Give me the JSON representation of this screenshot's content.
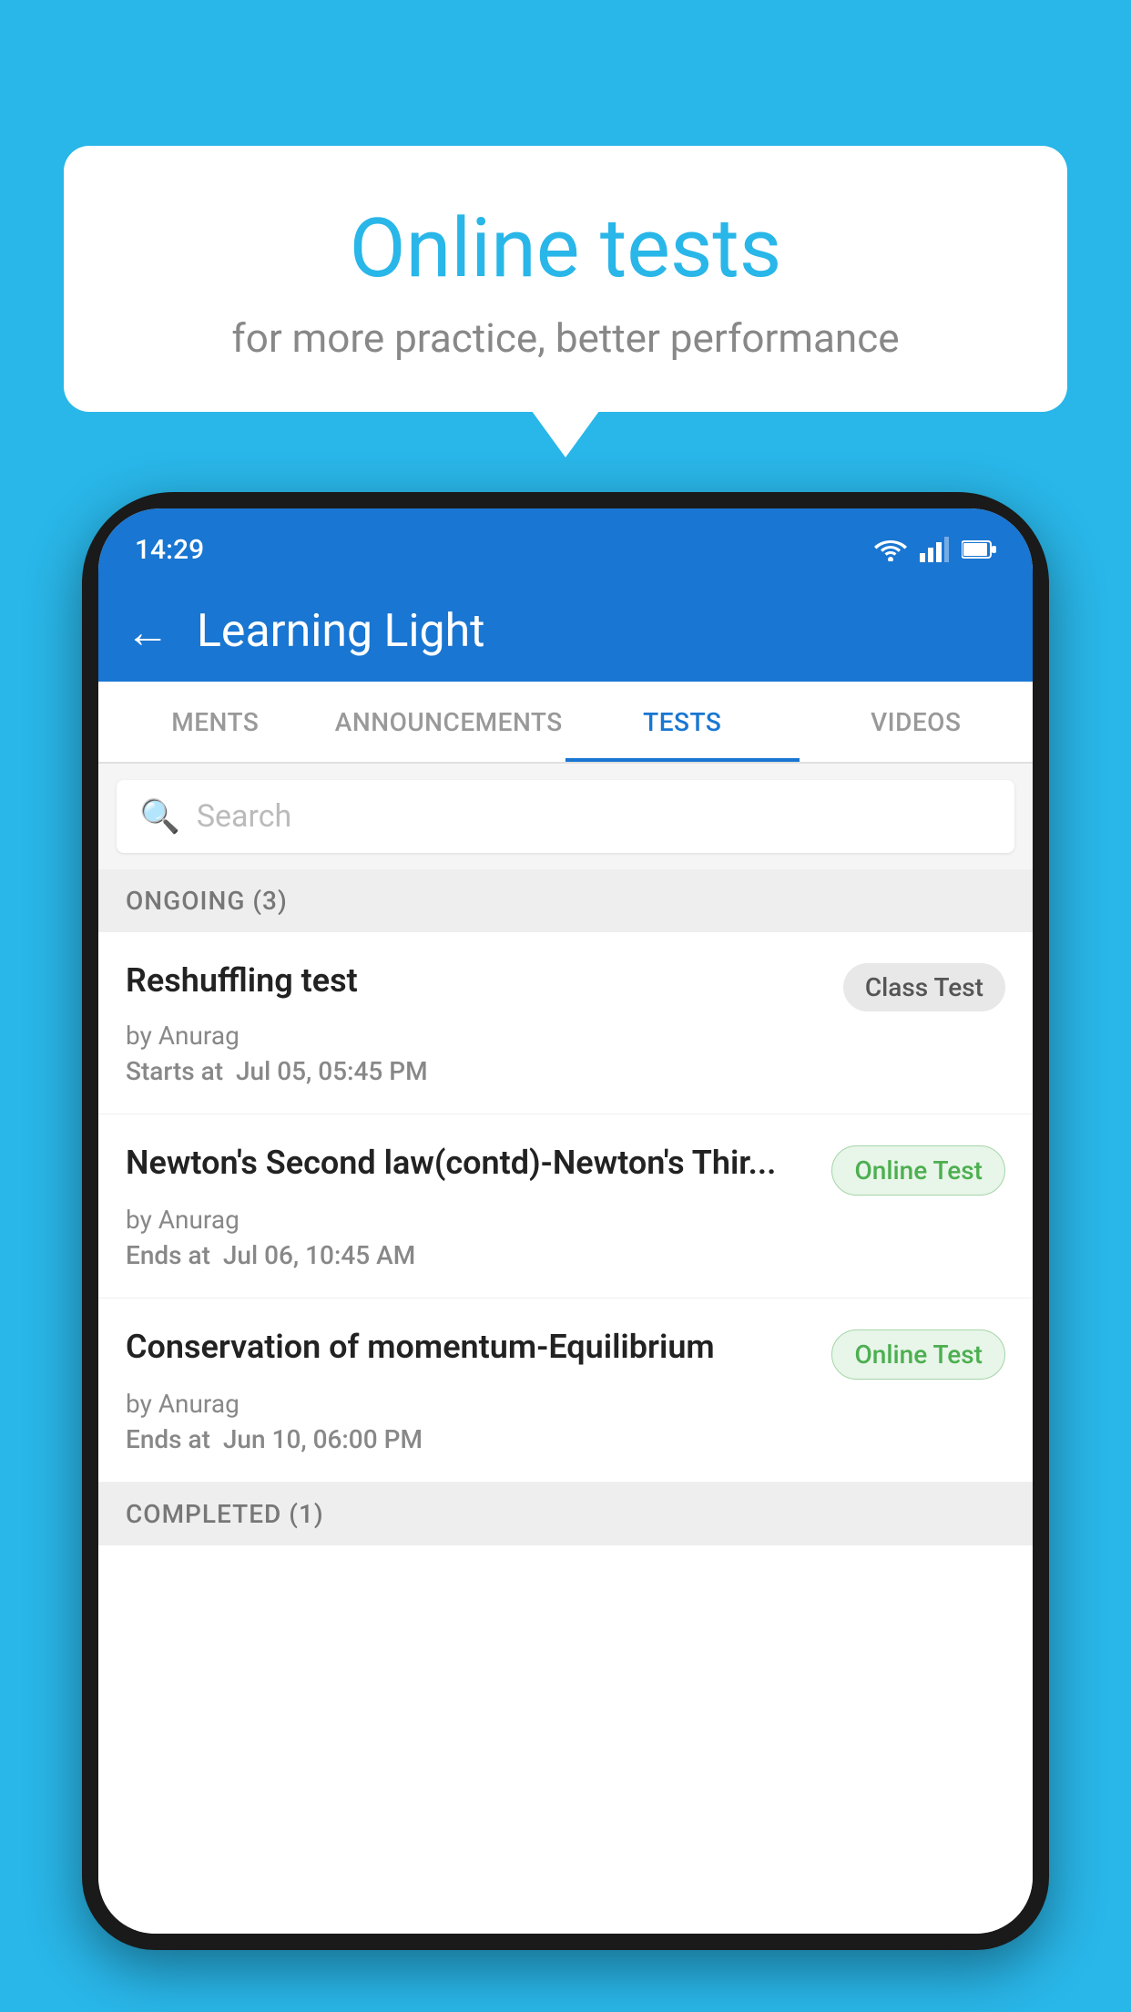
{
  "background": {
    "color": "#29b6e8"
  },
  "speech_bubble": {
    "title": "Online tests",
    "subtitle": "for more practice, better performance"
  },
  "phone": {
    "status_bar": {
      "time": "14:29"
    },
    "header": {
      "title": "Learning Light",
      "back_label": "←"
    },
    "tabs": [
      {
        "label": "MENTS",
        "active": false
      },
      {
        "label": "ANNOUNCEMENTS",
        "active": false
      },
      {
        "label": "TESTS",
        "active": true
      },
      {
        "label": "VIDEOS",
        "active": false
      }
    ],
    "search": {
      "placeholder": "Search"
    },
    "ongoing_section": {
      "label": "ONGOING (3)"
    },
    "tests": [
      {
        "name": "Reshuffling test",
        "badge": "Class Test",
        "badge_type": "class",
        "by": "by Anurag",
        "date_label": "Starts at",
        "date": "Jul 05, 05:45 PM"
      },
      {
        "name": "Newton's Second law(contd)-Newton's Thir...",
        "badge": "Online Test",
        "badge_type": "online",
        "by": "by Anurag",
        "date_label": "Ends at",
        "date": "Jul 06, 10:45 AM"
      },
      {
        "name": "Conservation of momentum-Equilibrium",
        "badge": "Online Test",
        "badge_type": "online",
        "by": "by Anurag",
        "date_label": "Ends at",
        "date": "Jun 10, 06:00 PM"
      }
    ],
    "completed_section": {
      "label": "COMPLETED (1)"
    }
  }
}
